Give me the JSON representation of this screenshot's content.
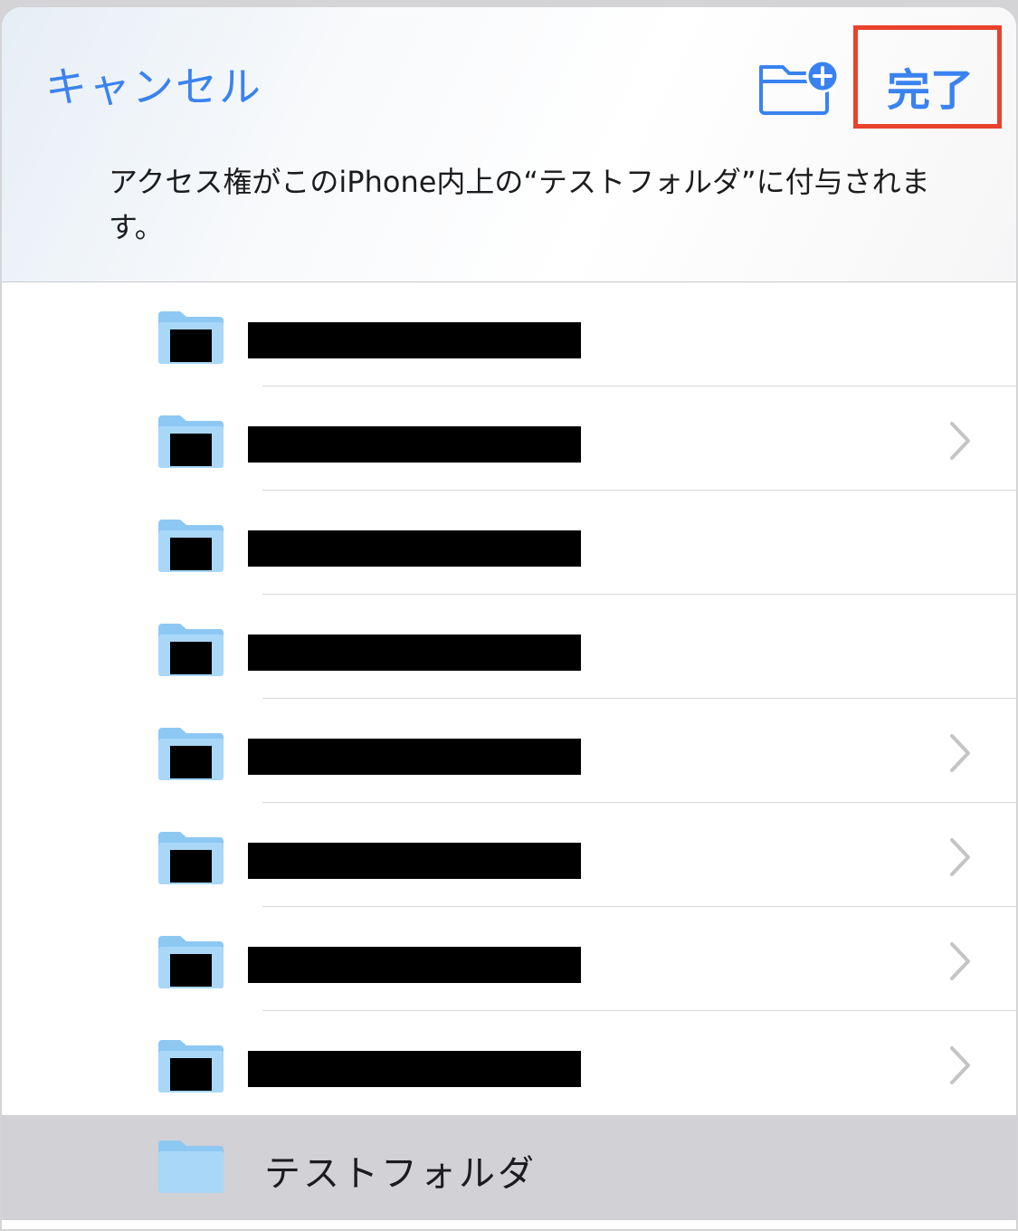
{
  "header": {
    "cancel_label": "キャンセル",
    "done_label": "完了",
    "new_folder_icon": "folder-plus-icon",
    "message": "アクセス権がこのiPhone内上の“テストフォルダ”に付与されます。"
  },
  "folders": [
    {
      "name": "",
      "redacted": true,
      "has_chevron": false
    },
    {
      "name": "",
      "redacted": true,
      "has_chevron": true
    },
    {
      "name": "",
      "redacted": true,
      "has_chevron": false
    },
    {
      "name": "",
      "redacted": true,
      "has_chevron": false
    },
    {
      "name": "",
      "redacted": true,
      "has_chevron": true
    },
    {
      "name": "",
      "redacted": true,
      "has_chevron": true
    },
    {
      "name": "",
      "redacted": true,
      "has_chevron": true
    },
    {
      "name": "",
      "redacted": true,
      "has_chevron": true
    }
  ],
  "selected_folder": {
    "name": "テストフォルダ",
    "selected": true
  },
  "colors": {
    "accent": "#3a82f0",
    "highlight_box": "#e8422c",
    "folder": "#8dc8f2",
    "selected_bg": "#d1d1d6"
  }
}
